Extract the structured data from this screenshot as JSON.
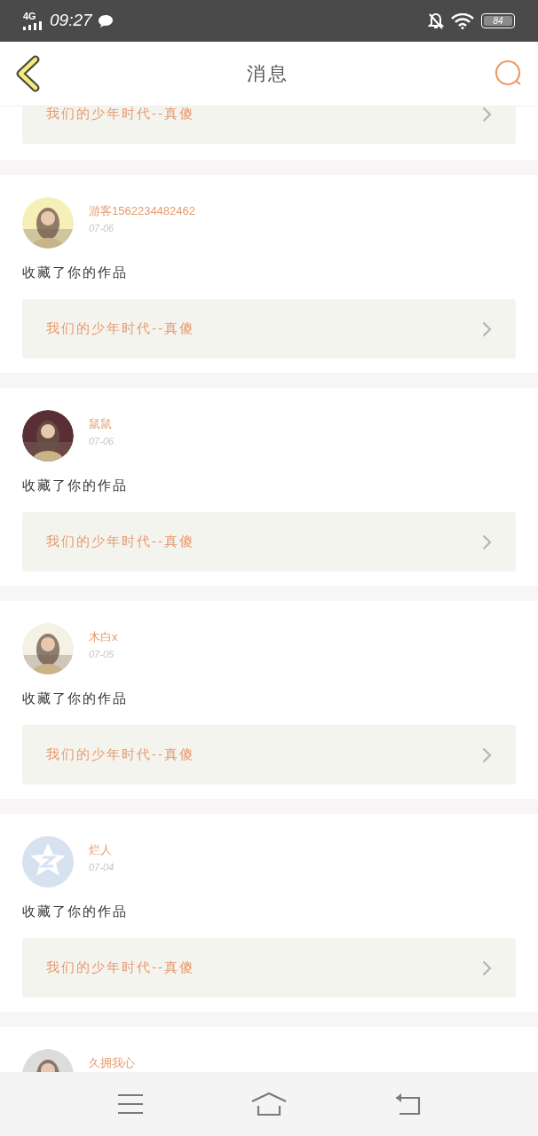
{
  "status_bar": {
    "network": "4G",
    "time": "09:27",
    "battery": "84"
  },
  "header": {
    "title": "消息"
  },
  "messages": [
    {
      "link": "我们的少年时代--真傻"
    },
    {
      "name": "游客1562234482462",
      "date": "07-06",
      "text": "收藏了你的作品",
      "link": "我们的少年时代--真傻"
    },
    {
      "name": "鼠鼠",
      "date": "07-06",
      "text": "收藏了你的作品",
      "link": "我们的少年时代--真傻"
    },
    {
      "name": "木白x",
      "date": "07-05",
      "text": "收藏了你的作品",
      "link": "我们的少年时代--真傻"
    },
    {
      "avatar": {
        "kind": "default"
      },
      "name": "烂人",
      "date": "07-04",
      "text": "收藏了你的作品",
      "link": "我们的少年时代--真傻"
    },
    {
      "name": "久拥我心"
    }
  ]
}
